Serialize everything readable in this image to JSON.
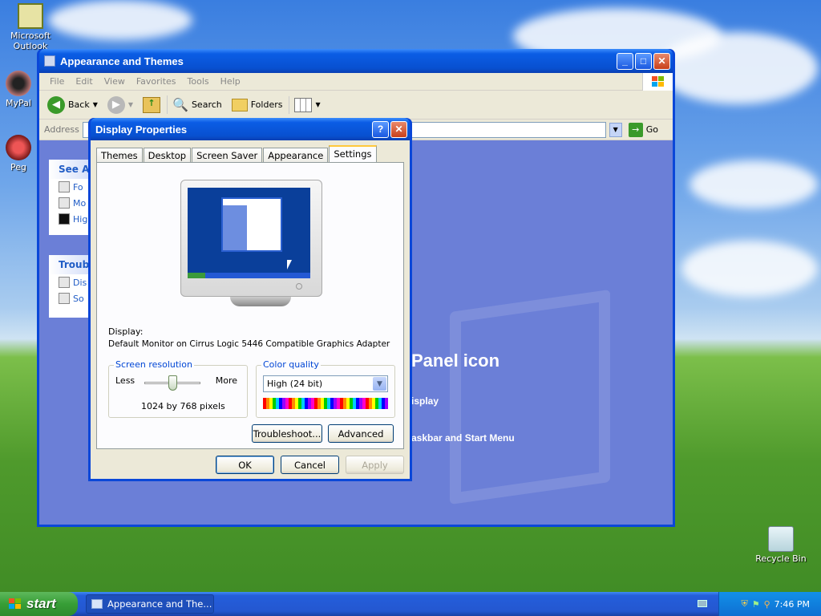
{
  "desktop": {
    "icons": [
      {
        "label": "Microsoft Outlook"
      },
      {
        "label": "MyPal"
      },
      {
        "label": "Peg"
      },
      {
        "label": "Recycle Bin"
      }
    ]
  },
  "explorer": {
    "title": "Appearance and Themes",
    "menu": [
      "File",
      "Edit",
      "View",
      "Favorites",
      "Tools",
      "Help"
    ],
    "toolbar": {
      "back": "Back",
      "search": "Search",
      "folders": "Folders"
    },
    "address_label": "Address",
    "go_label": "Go",
    "taskpane_see_also": {
      "title": "See Al",
      "items": [
        "Fo",
        "Mo",
        "Hig"
      ]
    },
    "taskpane_trouble": {
      "title": "Troubl",
      "items": [
        "Dis",
        "So"
      ]
    },
    "content": {
      "heading": "Panel icon",
      "link1": "isplay",
      "link2": "askbar and Start Menu"
    }
  },
  "dialog": {
    "title": "Display Properties",
    "tabs": [
      "Themes",
      "Desktop",
      "Screen Saver",
      "Appearance",
      "Settings"
    ],
    "active_tab": "Settings",
    "display_label": "Display:",
    "display_value": "Default Monitor on Cirrus Logic 5446 Compatible Graphics Adapter",
    "screen_resolution": {
      "legend": "Screen resolution",
      "less": "Less",
      "more": "More",
      "value": "1024 by 768 pixels",
      "slider_level": 0.5
    },
    "color_quality": {
      "legend": "Color quality",
      "selected": "High (24 bit)"
    },
    "buttons": {
      "troubleshoot": "Troubleshoot...",
      "advanced": "Advanced",
      "ok": "OK",
      "cancel": "Cancel",
      "apply": "Apply"
    }
  },
  "taskbar": {
    "start_label": "start",
    "task_label": "Appearance and The...",
    "clock": "7:46 PM"
  },
  "colors": {
    "xp_blue": "#0a47d8",
    "dialog_bg": "#ece9d8",
    "start_green": "#379e36",
    "legend_blue": "#0046d5"
  }
}
